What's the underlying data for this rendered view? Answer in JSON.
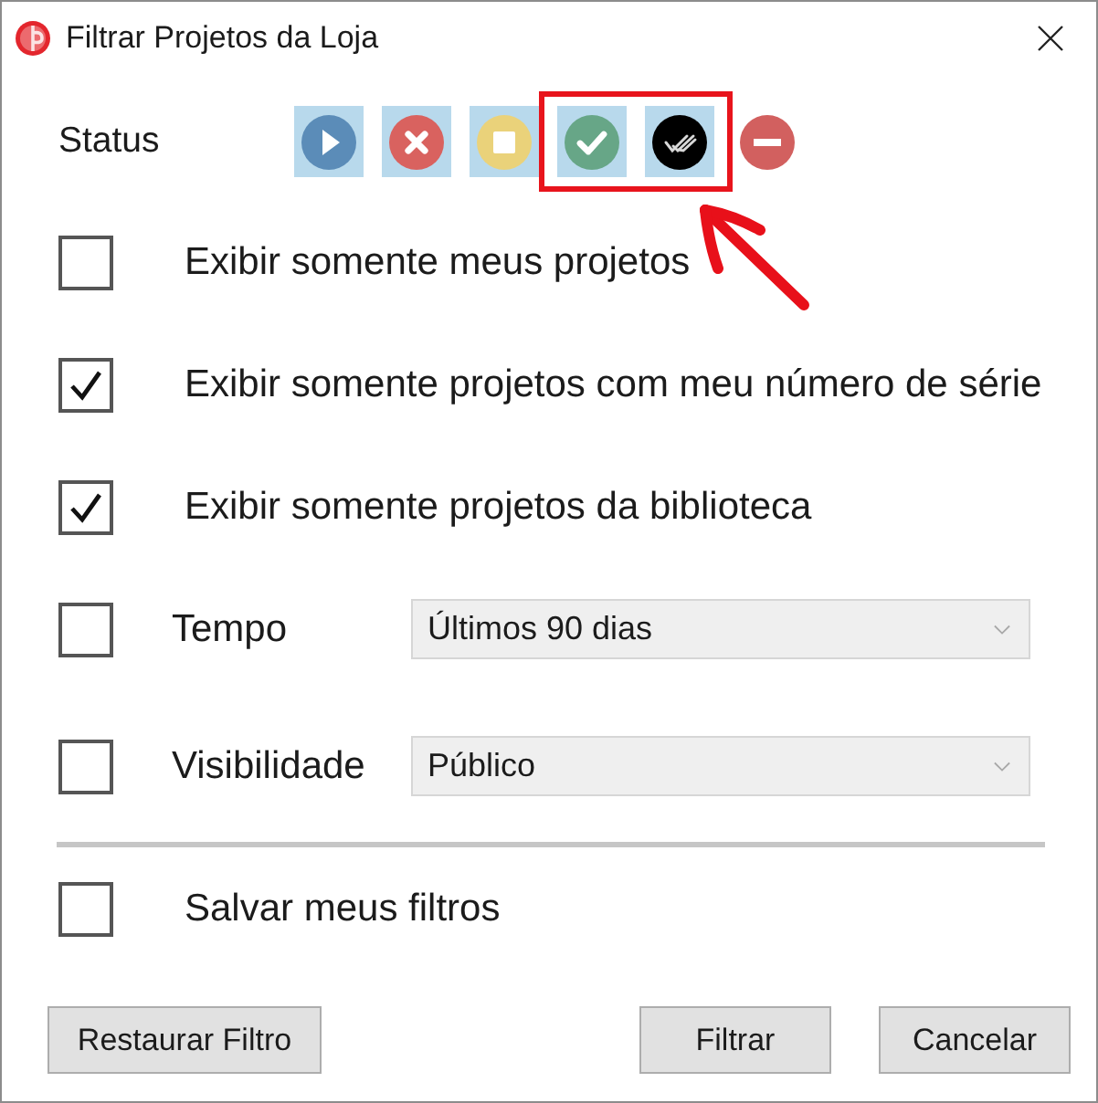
{
  "window": {
    "title": "Filtrar Projetos da Loja"
  },
  "status": {
    "label": "Status",
    "items": [
      {
        "kind": "play",
        "selected": true,
        "highlighted": false,
        "color": "#5b8cb8"
      },
      {
        "kind": "cancel",
        "selected": true,
        "highlighted": false,
        "color": "#d9625f"
      },
      {
        "kind": "stop",
        "selected": true,
        "highlighted": false,
        "color": "#ead27a"
      },
      {
        "kind": "check",
        "selected": true,
        "highlighted": true,
        "color": "#67a687"
      },
      {
        "kind": "double-check",
        "selected": true,
        "highlighted": true,
        "color": "#000000"
      },
      {
        "kind": "minus",
        "selected": false,
        "highlighted": false,
        "color": "#d2605f"
      }
    ]
  },
  "options": [
    {
      "kind": "checkbox",
      "label": "Exibir somente meus projetos",
      "checked": false
    },
    {
      "kind": "checkbox",
      "label": "Exibir somente projetos com meu número de série",
      "checked": true
    },
    {
      "kind": "checkbox",
      "label": "Exibir somente projetos da biblioteca",
      "checked": true
    },
    {
      "kind": "select",
      "label": "Tempo",
      "checked": false,
      "value": "Últimos 90 dias"
    },
    {
      "kind": "select",
      "label": "Visibilidade",
      "checked": false,
      "value": "Público"
    }
  ],
  "save_filters": {
    "label": "Salvar meus filtros",
    "checked": false
  },
  "buttons": [
    {
      "label": "Restaurar Filtro"
    },
    {
      "label": "Filtrar"
    },
    {
      "label": "Cancelar"
    }
  ]
}
